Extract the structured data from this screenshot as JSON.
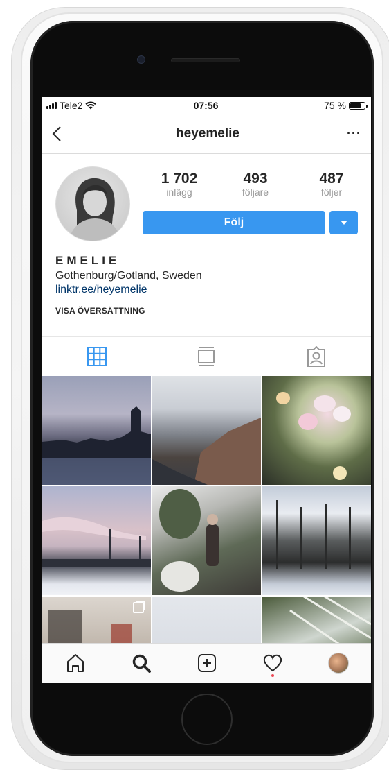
{
  "status_bar": {
    "carrier": "Tele2",
    "time": "07:56",
    "battery": "75 %",
    "battery_level": 0.75
  },
  "nav": {
    "title": "heyemelie",
    "more": "···"
  },
  "profile": {
    "stats": [
      {
        "value": "1 702",
        "label": "inlägg"
      },
      {
        "value": "493",
        "label": "följare"
      },
      {
        "value": "487",
        "label": "följer"
      }
    ],
    "follow_label": "Följ",
    "name": "EMELIE",
    "location": "Gothenburg/Gotland, Sweden",
    "link": "linktr.ee/heyemelie",
    "translate": "VISA ÖVERSÄTTNING"
  },
  "tabs": [
    "grid-icon",
    "list-icon",
    "tagged-icon"
  ],
  "grid": [
    {
      "name": "post-city-canal",
      "multi": false
    },
    {
      "name": "post-rocky-shore",
      "multi": false
    },
    {
      "name": "post-tulips",
      "multi": false
    },
    {
      "name": "post-smokestacks",
      "multi": false
    },
    {
      "name": "post-cafe-plants",
      "multi": false
    },
    {
      "name": "post-winter-forest",
      "multi": false
    },
    {
      "name": "post-interior",
      "multi": true
    },
    {
      "name": "post-sky",
      "multi": false
    },
    {
      "name": "post-greenhouse",
      "multi": false
    }
  ],
  "tabbar": [
    "home-icon",
    "search-icon",
    "add-icon",
    "heart-icon",
    "profile-avatar"
  ]
}
